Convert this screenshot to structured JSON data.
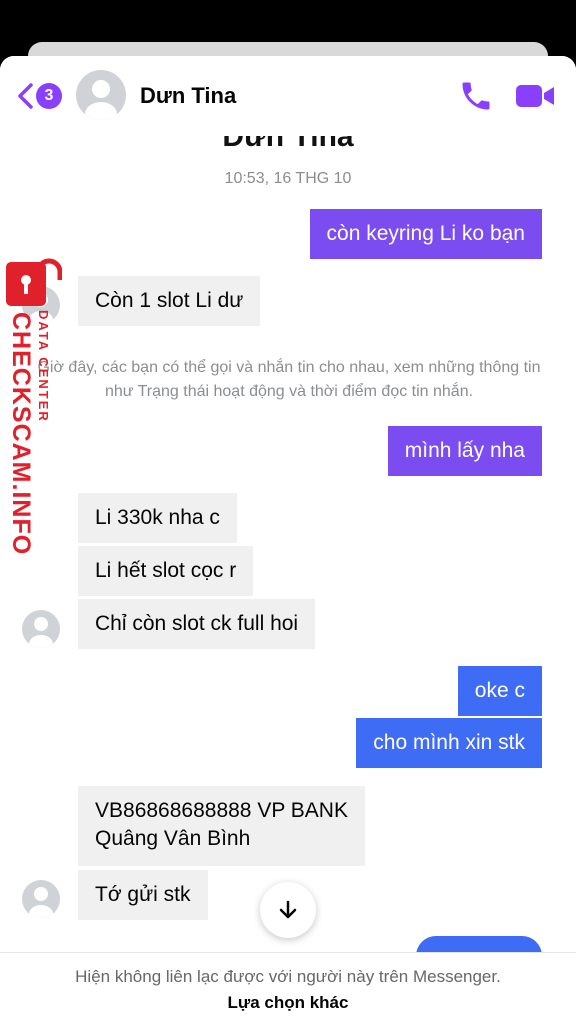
{
  "header": {
    "back_badge": "3",
    "contact_name": "Dưn Tina",
    "icons": {
      "back": "chevron-left-icon",
      "call": "phone-icon",
      "video": "video-camera-icon"
    },
    "accent_color": "#8a3ffc"
  },
  "conversation": {
    "profile_name_partial": "Dưn Tina",
    "timestamp": "10:53, 16 THG 10",
    "info_notice": "Giờ đây, các bạn có thể gọi và nhắn tin cho nhau, xem những thông tin như Trạng thái hoạt động và thời điểm đọc tin nhắn.",
    "messages": [
      {
        "from": "me",
        "text": "còn keyring Li ko bạn"
      },
      {
        "from": "them",
        "text": "Còn 1 slot Li dư"
      },
      {
        "from": "me",
        "text": "mình lấy nha"
      },
      {
        "from": "them",
        "text": "Li 330k nha c"
      },
      {
        "from": "them",
        "text": "Li hết slot cọc r"
      },
      {
        "from": "them",
        "text": "Chỉ còn slot ck full hoi"
      },
      {
        "from": "me",
        "text": "oke c"
      },
      {
        "from": "me",
        "text": "cho mình xin stk"
      },
      {
        "from": "them",
        "line1": "VB86868688888 VP BANK",
        "line2": "Quâng Vân Bình"
      },
      {
        "from": "them",
        "text": "Tớ gửi stk"
      }
    ]
  },
  "watermark": {
    "main": "CHECKSCAM.INFO",
    "sub": "DATA CENTER",
    "icon": "padlock-icon",
    "color": "#e0202a"
  },
  "scroll_button": {
    "icon": "arrow-down-icon"
  },
  "footer": {
    "note": "Hiện không liên lạc được với người này trên Messenger.",
    "action": "Lựa chọn khác"
  }
}
